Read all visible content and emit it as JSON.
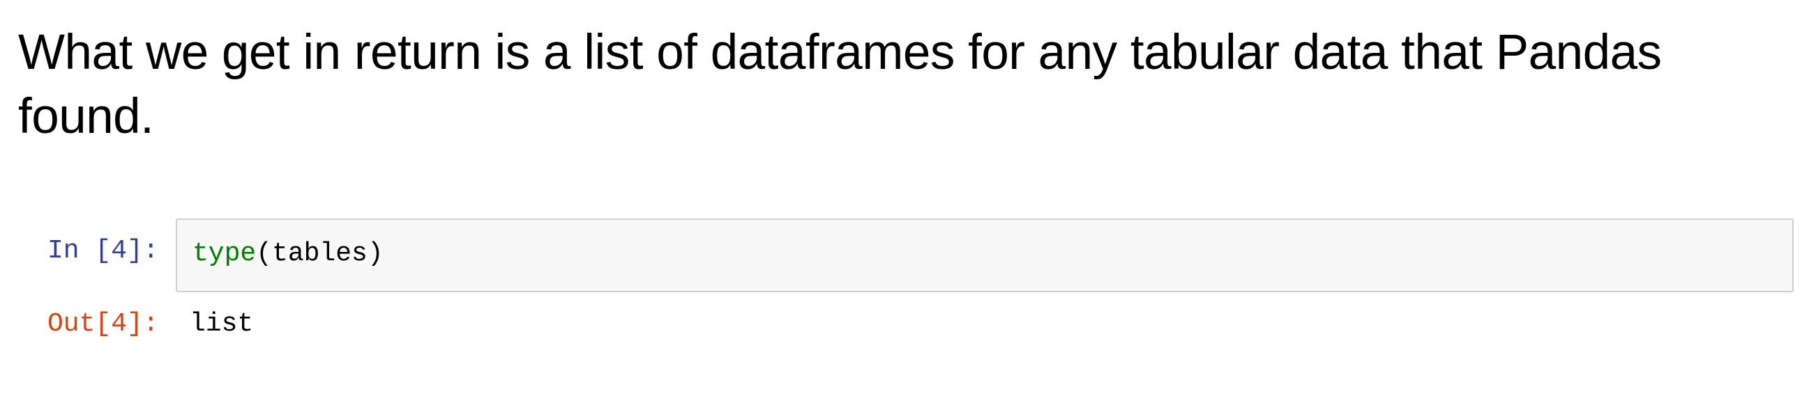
{
  "markdown": {
    "text": "What we get in return is a list of dataframes for any tabular data that Pandas found."
  },
  "input_cell": {
    "prompt": "In [4]:",
    "code_builtin": "type",
    "code_rest": "(tables)"
  },
  "output_cell": {
    "prompt": "Out[4]:",
    "text": "list"
  },
  "colors": {
    "in_prompt": "#303f9f",
    "out_prompt": "#d84315",
    "builtin": "#008000",
    "input_background": "#f7f7f7"
  }
}
